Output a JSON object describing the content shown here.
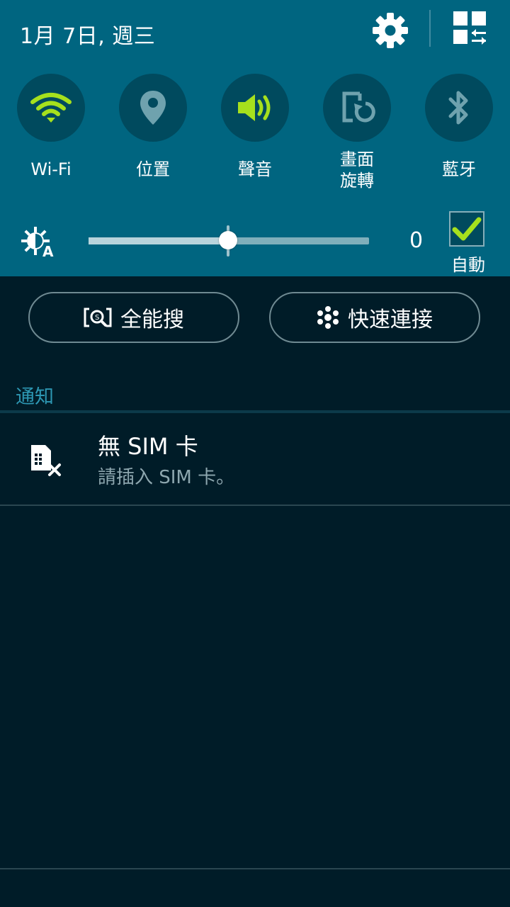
{
  "status": {
    "date": "1月 7日, 週三"
  },
  "header_icons": {
    "settings": "gear-icon",
    "edit": "grid-swap-icon"
  },
  "quick_toggles": [
    {
      "label": "Wi-Fi",
      "icon": "wifi-icon",
      "active": true
    },
    {
      "label": "位置",
      "icon": "location-pin-icon",
      "active": false
    },
    {
      "label": "聲音",
      "icon": "speaker-icon",
      "active": true
    },
    {
      "label": "畫面\n旋轉",
      "icon": "screen-rotation-icon",
      "active": false
    },
    {
      "label": "藍牙",
      "icon": "bluetooth-icon",
      "active": false
    }
  ],
  "brightness": {
    "value": "0",
    "level": 0.5,
    "auto_label": "自動",
    "auto_checked": true
  },
  "buttons": {
    "search_label": "全能搜",
    "quick_connect_label": "快速連接"
  },
  "notifications": {
    "section_title": "通知",
    "items": [
      {
        "title": "無 SIM 卡",
        "subtitle": "請插入 SIM 卡。",
        "icon": "no-sim-icon"
      }
    ]
  },
  "colors": {
    "panel_bg": "#006580",
    "toggle_bg": "#004a5e",
    "active_green": "#a6e01d",
    "body_bg": "#001c28",
    "accent_blue": "#2d97b3"
  }
}
